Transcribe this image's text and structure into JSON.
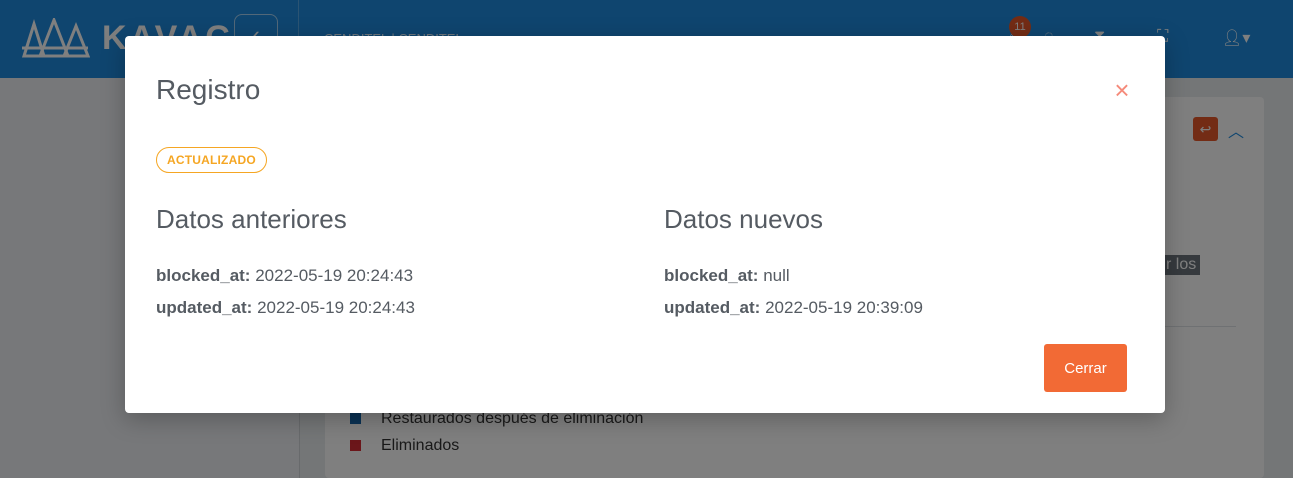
{
  "app": {
    "logo_text": "KAVAC",
    "org_name": "CENDITEL | CENDITEL",
    "notifications_count": "11"
  },
  "background_card": {
    "tooltip_fragment": "r los",
    "legend": [
      {
        "label": "Restaurados después de eliminación",
        "color": "#1565a8"
      },
      {
        "label": "Eliminados",
        "color": "#d62c35"
      }
    ]
  },
  "modal": {
    "title": "Registro",
    "close_icon": "×",
    "status_badge": "ACTUALIZADO",
    "status_color": "#f5a623",
    "old_data": {
      "heading": "Datos anteriores",
      "fields": [
        {
          "key": "blocked_at:",
          "value": "2022-05-19 20:24:43"
        },
        {
          "key": "updated_at:",
          "value": "2022-05-19 20:24:43"
        }
      ]
    },
    "new_data": {
      "heading": "Datos nuevos",
      "fields": [
        {
          "key": "blocked_at:",
          "value": "null"
        },
        {
          "key": "updated_at:",
          "value": "2022-05-19 20:39:09"
        }
      ]
    },
    "close_button_label": "Cerrar",
    "accent_color": "#f26a35"
  }
}
